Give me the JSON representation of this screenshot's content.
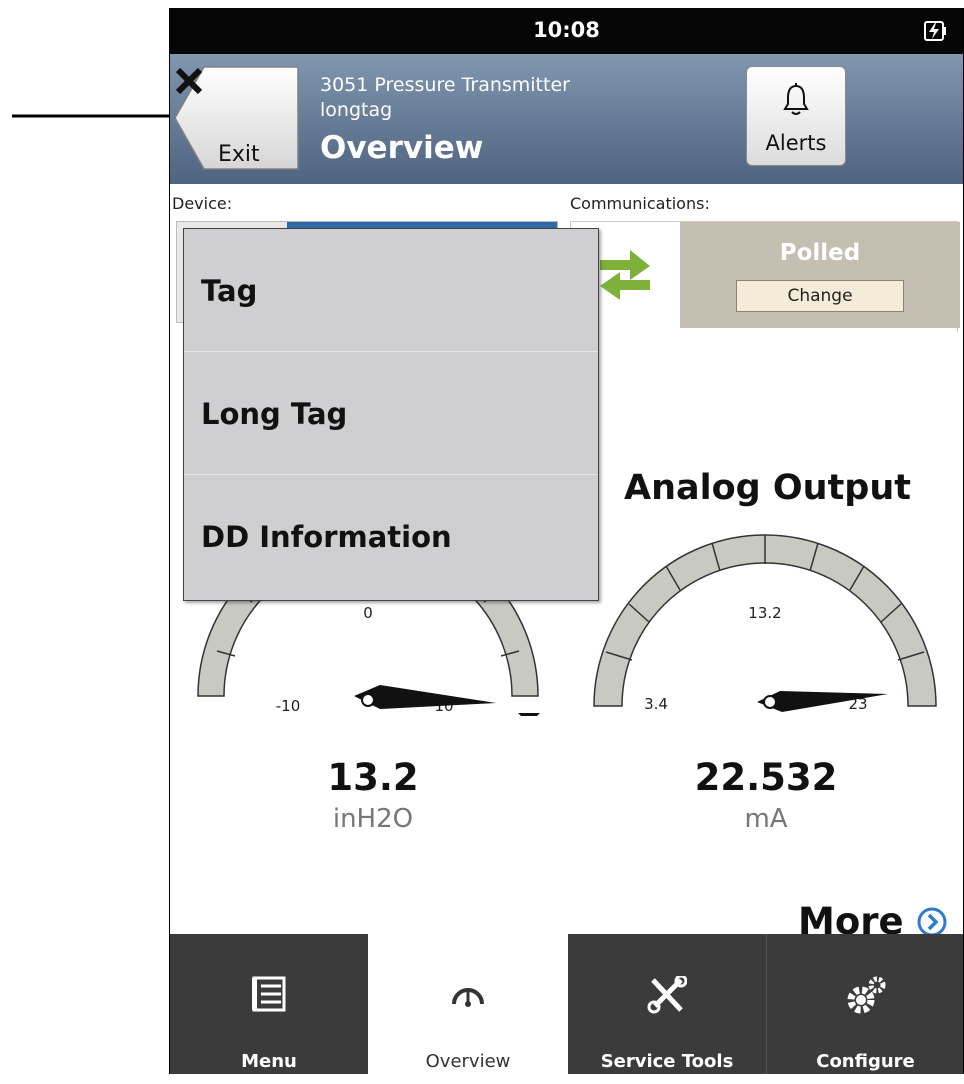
{
  "status_bar": {
    "time": "10:08"
  },
  "header": {
    "exit_label": "Exit",
    "device_name": "3051 Pressure Transmitter",
    "device_tag": "longtag",
    "page_title": "Overview",
    "alerts_label": "Alerts"
  },
  "device_section": {
    "label": "Device:"
  },
  "communications": {
    "label": "Communications:",
    "status": "Polled",
    "change_label": "Change"
  },
  "dropdown": {
    "items": [
      {
        "label": "Tag"
      },
      {
        "label": "Long Tag"
      },
      {
        "label": "DD Information"
      }
    ]
  },
  "gauges": [
    {
      "title": "",
      "value": "13.2",
      "unit": "inH2O",
      "tick_labels": {
        "min": "-10",
        "mid": "0",
        "max": "10"
      },
      "pointer_fraction": 0.97
    },
    {
      "title": "Analog Output",
      "value": "22.532",
      "unit": "mA",
      "tick_labels": {
        "min": "3.4",
        "mid": "13.2",
        "max": "23"
      },
      "pointer_fraction": 0.97
    }
  ],
  "more": {
    "label": "More"
  },
  "bottom_nav": [
    {
      "label": "Menu",
      "icon": "menu-list-icon",
      "active": false
    },
    {
      "label": "Overview",
      "icon": "gauge-icon",
      "active": true
    },
    {
      "label": "Service Tools",
      "icon": "wrench-screwdriver-icon",
      "active": false
    },
    {
      "label": "Configure",
      "icon": "gears-icon",
      "active": false
    }
  ],
  "colors": {
    "header": "#6a7f9a",
    "polled_box": "#c4bfb0",
    "nav_dark": "#3b3b3b",
    "more_accent": "#2e7bd0",
    "arrows_green": "#7fb03a"
  }
}
